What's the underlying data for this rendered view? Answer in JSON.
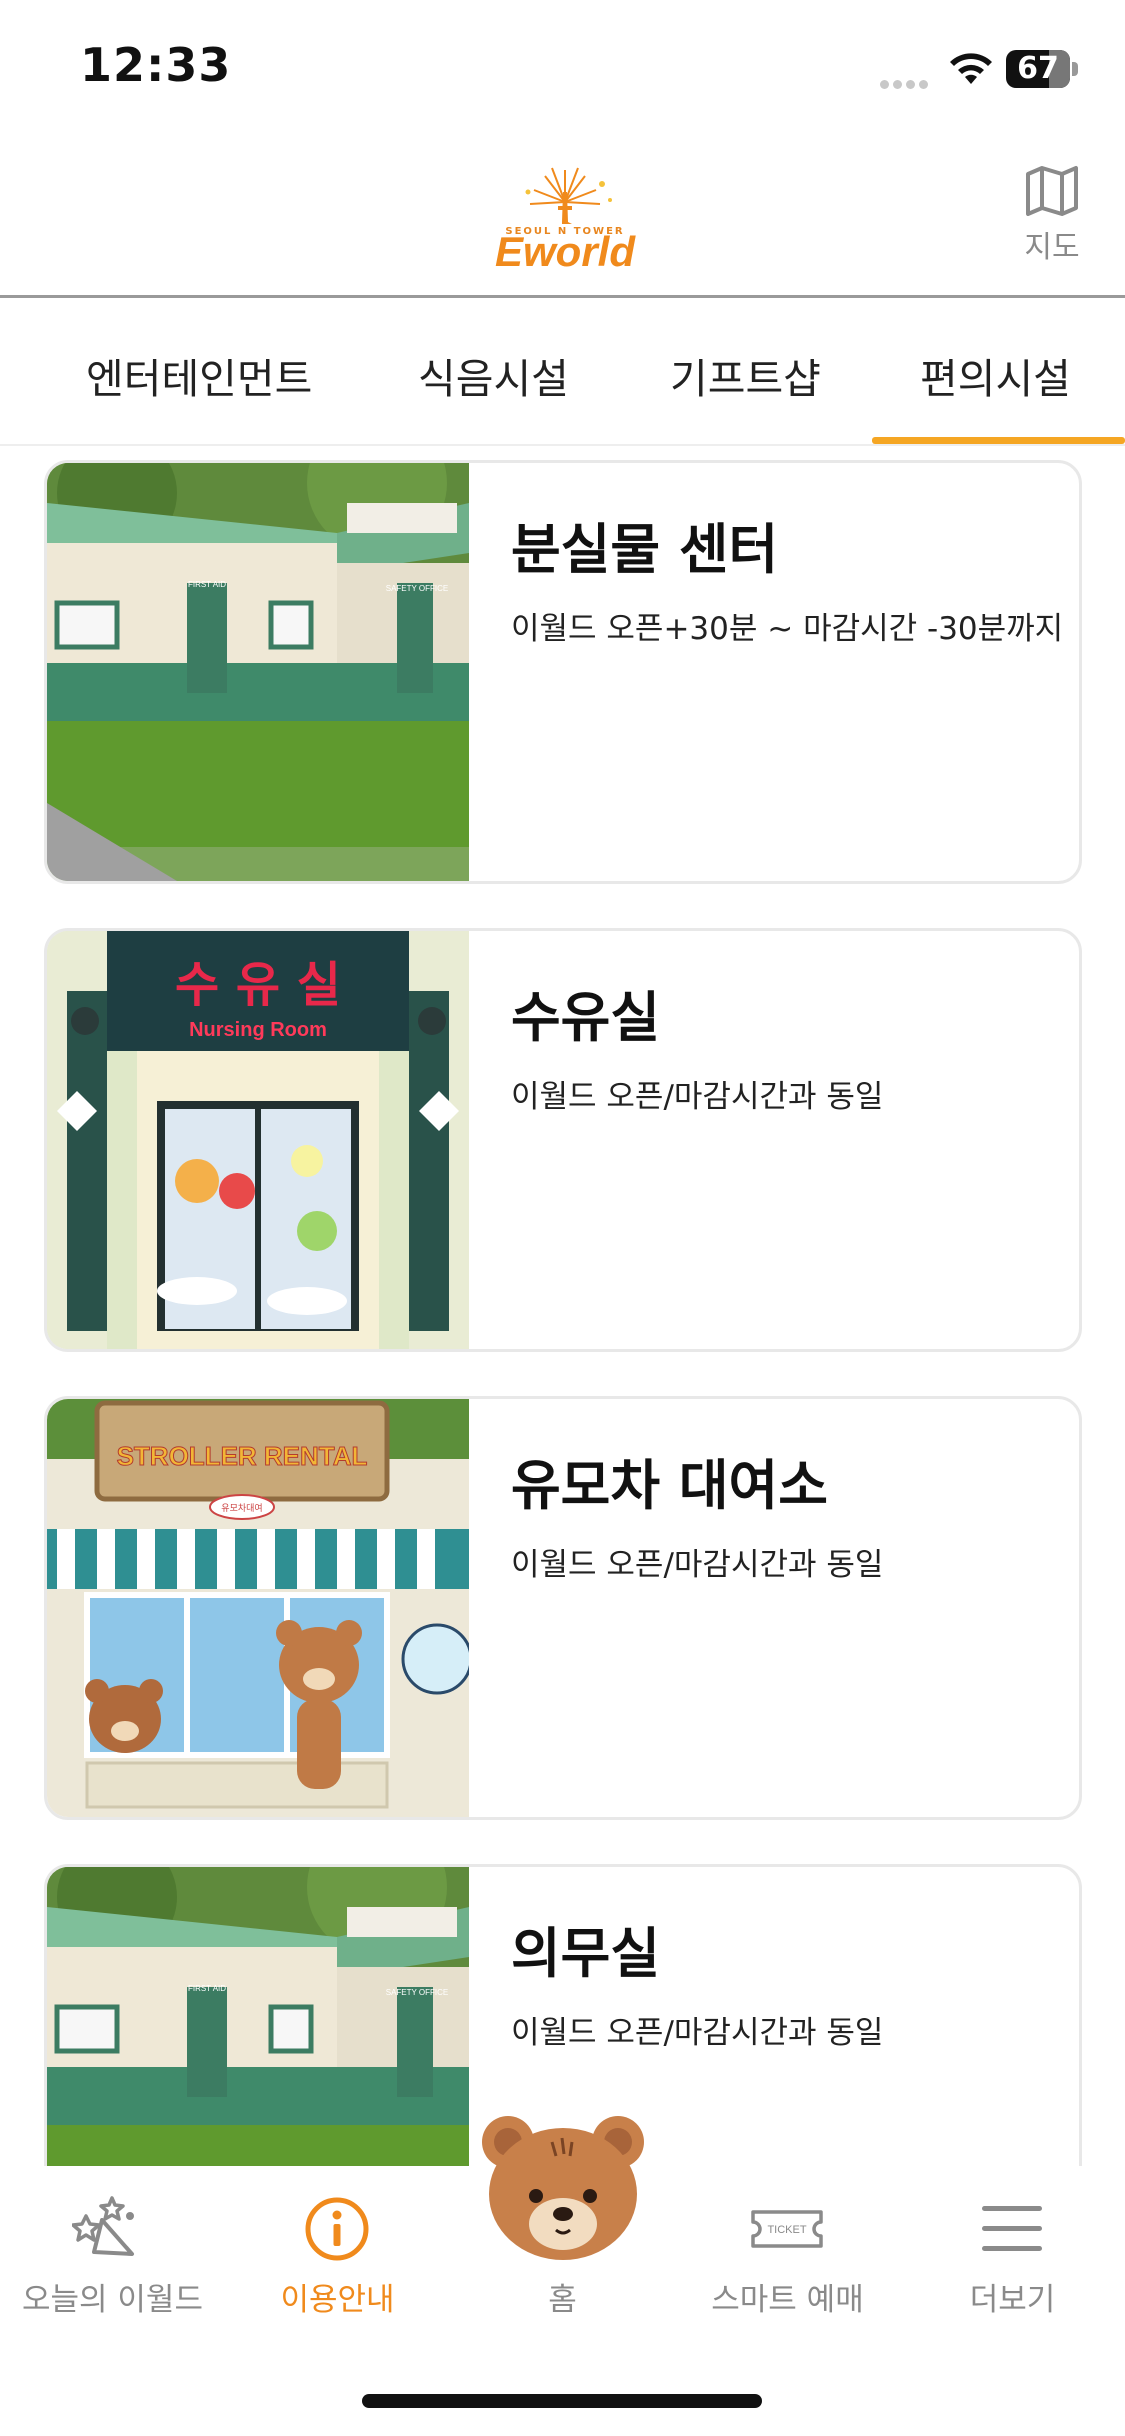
{
  "status": {
    "time": "12:33",
    "battery": "67"
  },
  "header": {
    "logo_small": "SEOUL N TOWER",
    "logo_text": "Eworld",
    "map_label": "지도"
  },
  "tabs": [
    {
      "label": "엔터테인먼트",
      "active": false
    },
    {
      "label": "식음시설",
      "active": false
    },
    {
      "label": "기프트샵",
      "active": false
    },
    {
      "label": "편의시설",
      "active": true
    }
  ],
  "cards": [
    {
      "title": "분실물 센터",
      "hours": "이월드 오픈+30분 ~ 마감시간 -30분까지",
      "image": "first-aid-building",
      "sign_left": "FIRST AID",
      "sign_right": "SAFETY OFFICE"
    },
    {
      "title": "수유실",
      "hours": "이월드 오픈/마감시간과 동일",
      "image": "nursing-room",
      "sign_korean": "수 유 실",
      "sign_english": "Nursing Room"
    },
    {
      "title": "유모차 대여소",
      "hours": "이월드 오픈/마감시간과 동일",
      "image": "stroller-rental",
      "sign": "STROLLER RENTAL",
      "small_sign": "유모차대여"
    },
    {
      "title": "의무실",
      "hours": "이월드 오픈/마감시간과 동일",
      "image": "first-aid-building",
      "sign_left": "FIRST AID",
      "sign_right": "SAFETY OFFICE"
    }
  ],
  "bottom_nav": [
    {
      "label": "오늘의 이월드",
      "icon": "party-icon",
      "active": false
    },
    {
      "label": "이용안내",
      "icon": "info-icon",
      "active": true
    },
    {
      "label": "홈",
      "icon": "bear-home-icon",
      "active": false
    },
    {
      "label": "스마트 예매",
      "icon": "ticket-icon",
      "active": false,
      "icon_text": "TICKET"
    },
    {
      "label": "더보기",
      "icon": "menu-icon",
      "active": false
    }
  ],
  "colors": {
    "accent": "#f5a623",
    "orange": "#f08a1c",
    "inactive": "#8a8a8a"
  }
}
